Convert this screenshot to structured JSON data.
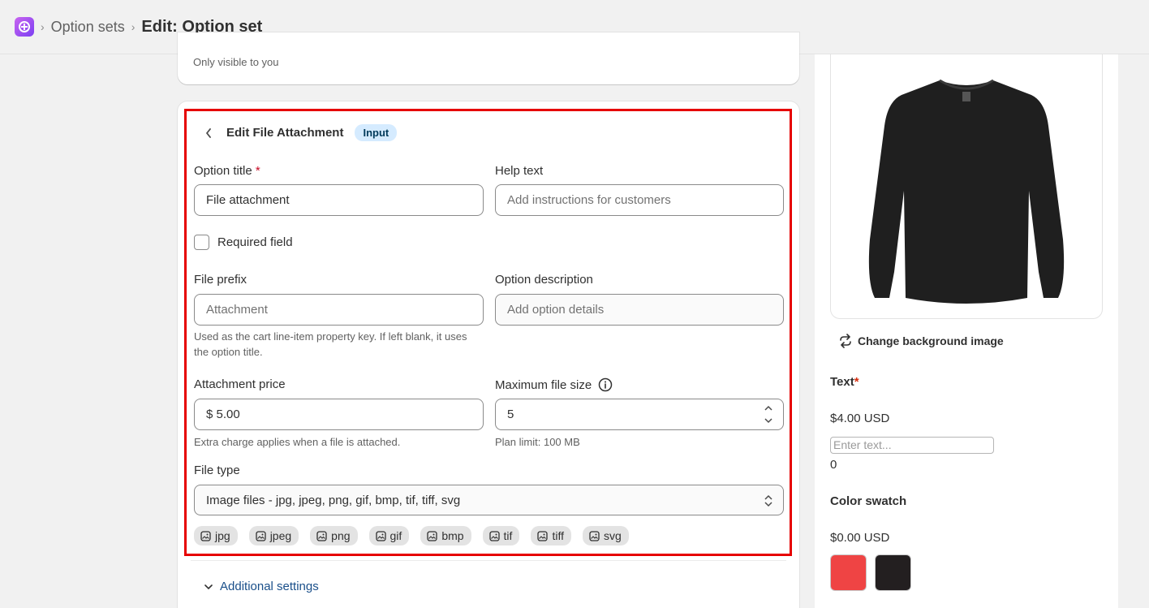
{
  "breadcrumb": {
    "app_icon": "app-logo-icon",
    "parent": "Option sets",
    "current": "Edit: Option set"
  },
  "top_card": {
    "note": "Only visible to you"
  },
  "editor": {
    "title": "Edit File Attachment",
    "badge": "Input",
    "option_title_label": "Option title",
    "option_title_required": "*",
    "option_title_value": "File attachment",
    "help_text_label": "Help text",
    "help_text_placeholder": "Add instructions for customers",
    "required_label": "Required field",
    "required_checked": false,
    "file_prefix_label": "File prefix",
    "file_prefix_placeholder": "Attachment",
    "file_prefix_help": "Used as the cart line-item property key. If left blank, it uses the option title.",
    "option_description_label": "Option description",
    "option_description_placeholder": "Add option details",
    "attachment_price_label": "Attachment price",
    "attachment_price_value": "$ 5.00",
    "attachment_price_help": "Extra charge applies when a file is attached.",
    "max_size_label": "Maximum file size",
    "max_size_value": "5",
    "max_size_help": "Plan limit: 100 MB",
    "file_type_label": "File type",
    "file_type_value": "Image files - jpg, jpeg, png, gif, bmp, tif, tiff, svg",
    "file_types": [
      "jpg",
      "jpeg",
      "png",
      "gif",
      "bmp",
      "tif",
      "tiff",
      "svg"
    ],
    "additional_settings": "Additional settings"
  },
  "preview": {
    "change_bg": "Change background image",
    "text_option": {
      "title": "Text",
      "required": "*",
      "price": "$4.00 USD",
      "placeholder": "Enter text...",
      "count": "0"
    },
    "color_option": {
      "title": "Color swatch",
      "price": "$0.00 USD",
      "swatches": [
        "#ef4444",
        "#231f20"
      ]
    }
  },
  "colors": {
    "highlight_border": "#e60000",
    "badge_bg": "#d5ebff"
  }
}
